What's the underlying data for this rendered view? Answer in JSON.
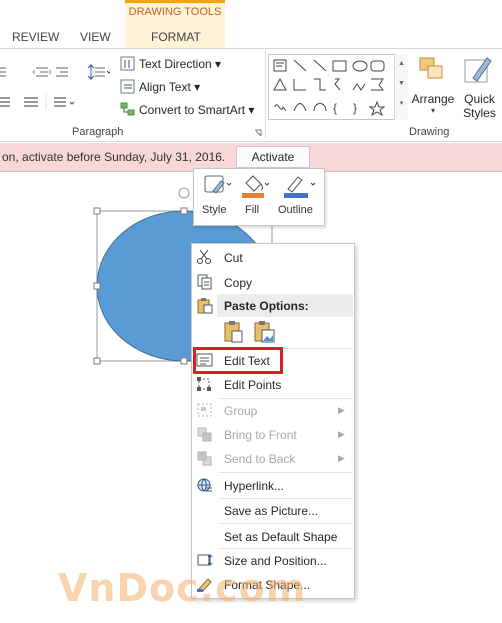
{
  "ribbon": {
    "contextual_tab_group": "DRAWING TOOLS",
    "tabs": [
      {
        "label": "REVIEW"
      },
      {
        "label": "VIEW"
      },
      {
        "label": "FORMAT"
      }
    ],
    "paragraph": {
      "text_direction": "Text Direction",
      "align_text": "Align Text",
      "convert_smartart": "Convert to SmartArt",
      "group_label": "Paragraph"
    },
    "drawing": {
      "arrange": "Arrange",
      "quick_styles_line1": "Quick",
      "quick_styles_line2": "Styles",
      "group_label": "Drawing"
    }
  },
  "notification": {
    "message": "on, activate before Sunday, July 31, 2016.",
    "activate_button": "Activate",
    "background_color": "#f8d7d8"
  },
  "mini_toolbar": {
    "style": "Style",
    "fill": "Fill",
    "outline": "Outline"
  },
  "shape": {
    "fill_color": "#5b9bd5"
  },
  "context_menu": {
    "items": [
      {
        "label": "Cut",
        "icon": "scissors-icon",
        "enabled": true
      },
      {
        "label": "Copy",
        "icon": "copy-icon",
        "enabled": true
      },
      {
        "label": "Paste Options:",
        "icon": "paste-icon",
        "enabled": true
      },
      {
        "label": "Edit Text",
        "icon": "edit-text-icon",
        "enabled": true,
        "highlighted": true
      },
      {
        "label": "Edit Points",
        "icon": "edit-points-icon",
        "enabled": true
      },
      {
        "label": "Group",
        "icon": "group-icon",
        "enabled": false,
        "submenu": true
      },
      {
        "label": "Bring to Front",
        "icon": "bring-front-icon",
        "enabled": false,
        "submenu": true
      },
      {
        "label": "Send to Back",
        "icon": "send-back-icon",
        "enabled": false,
        "submenu": true
      },
      {
        "label": "Hyperlink...",
        "icon": "hyperlink-icon",
        "enabled": true
      },
      {
        "label": "Save as Picture...",
        "icon": "",
        "enabled": true
      },
      {
        "label": "Set as Default Shape",
        "icon": "",
        "enabled": true
      },
      {
        "label": "Size and Position...",
        "icon": "size-position-icon",
        "enabled": true
      },
      {
        "label": "Format Shape...",
        "icon": "format-shape-icon",
        "enabled": true
      }
    ],
    "highlight_color": "#e31c24"
  },
  "watermark": "VnDoc.com"
}
